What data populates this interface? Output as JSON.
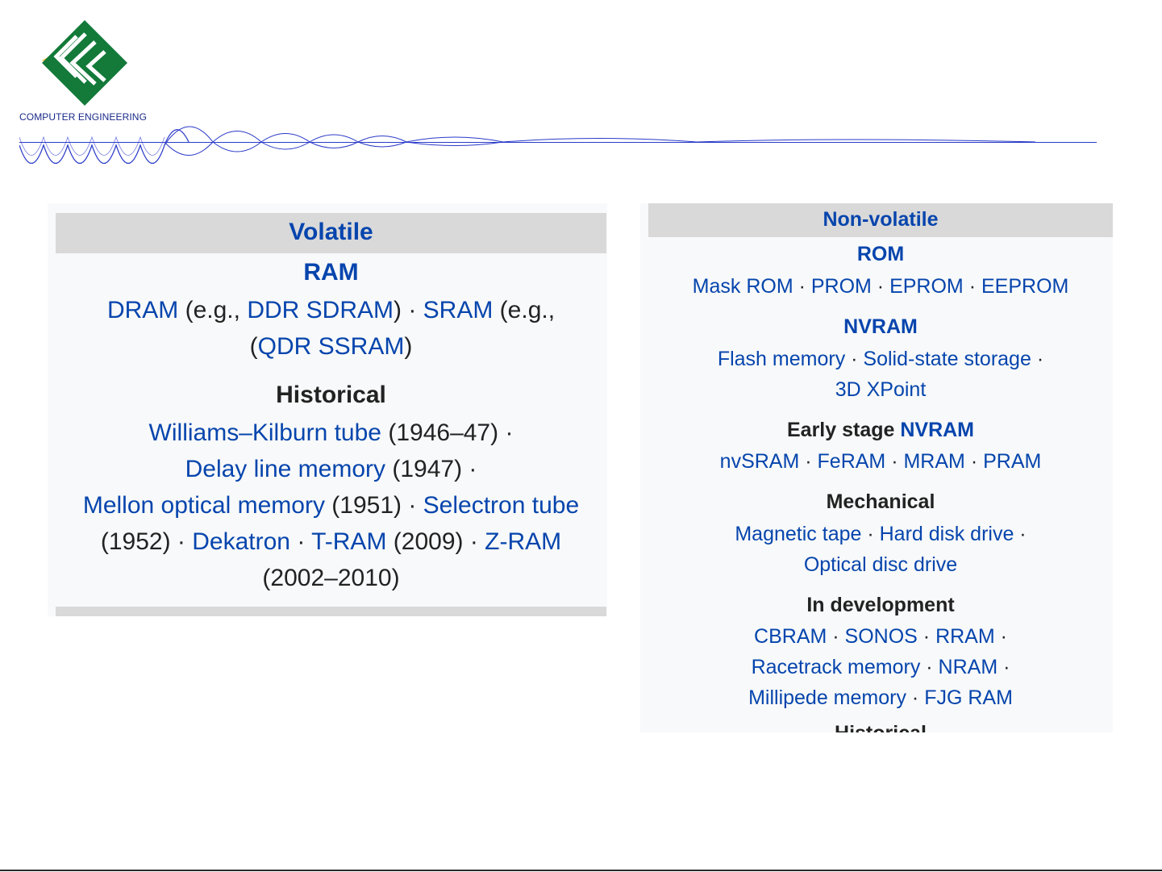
{
  "header": {
    "logo_text": "COMPUTER ENGINEERING",
    "accent_color": "#1a8a3a",
    "rule_color": "#2a3ac8"
  },
  "volatile": {
    "title": "Volatile",
    "ram_title": "RAM",
    "ram": {
      "dram": "DRAM",
      "eg1": " (e.g., ",
      "ddr": "DDR SDRAM",
      "close1": ") · ",
      "sram": "SRAM",
      "eg2": " (e.g.,",
      "open2": "(",
      "qdr": "QDR SSRAM",
      "close2": ")"
    },
    "historical_title": "Historical",
    "historical": {
      "williams": "Williams–Kilburn tube",
      "williams_year": " (1946–47) ·",
      "delay": "Delay line memory",
      "delay_year": " (1947) ·",
      "mellon": "Mellon optical memory",
      "mellon_year": " (1951) · ",
      "selectron": "Selectron tube",
      "selectron_year": "(1952) · ",
      "dekatron": "Dekatron",
      "tram": "T-RAM",
      "tram_year": " (2009) · ",
      "zram": "Z-RAM",
      "zram_year": "(2002–2010)"
    }
  },
  "nonvolatile": {
    "title": "Non-volatile",
    "rom_title": "ROM",
    "rom": [
      "Mask ROM",
      "PROM",
      "EPROM",
      "EEPROM"
    ],
    "nvram_title": "NVRAM",
    "nvram": {
      "flash": "Flash memory",
      "ssd": "Solid-state storage",
      "xpoint": "3D XPoint"
    },
    "early_prefix": "Early stage ",
    "early_link": "NVRAM",
    "early": [
      "nvSRAM",
      "FeRAM",
      "MRAM",
      "PRAM"
    ],
    "mech_title": "Mechanical",
    "mech": {
      "tape": "Magnetic tape",
      "hdd": "Hard disk drive",
      "optical": "Optical disc drive"
    },
    "dev_title": "In development",
    "dev": {
      "cbram": "CBRAM",
      "sonos": "SONOS",
      "rram": "RRAM",
      "racetrack": "Racetrack memory",
      "nram": "NRAM",
      "millipede": "Millipede memory",
      "fjg": "FJG RAM"
    },
    "hist_cut": "Historical"
  },
  "separator": " · "
}
